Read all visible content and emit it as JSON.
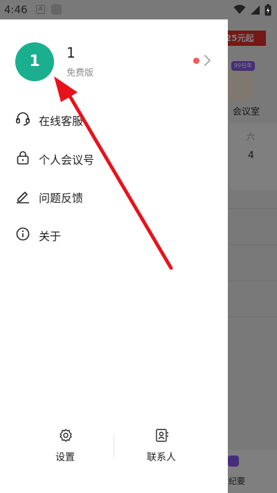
{
  "status_bar": {
    "time": "4:46",
    "notification_a": "A"
  },
  "profile": {
    "avatar_initial": "1",
    "name": "1",
    "plan": "免费版"
  },
  "menu": [
    {
      "label": "在线客服",
      "icon": "headset-icon"
    },
    {
      "label": "个人会议号",
      "icon": "lock-icon"
    },
    {
      "label": "问题反馈",
      "icon": "edit-icon"
    },
    {
      "label": "关于",
      "icon": "info-icon"
    }
  ],
  "bottom_bar": {
    "settings_label": "设置",
    "contacts_label": "联系人"
  },
  "background": {
    "promo_text": ".25元起",
    "badge": "99包年",
    "room_label": "会议室",
    "weekday": "六",
    "date": "4",
    "nav_label": "纪要"
  },
  "colors": {
    "avatar": "#1aaf8f",
    "notification_dot": "#ef5b5b",
    "annotation_arrow": "#e8121b",
    "promo": "#e8332c"
  }
}
